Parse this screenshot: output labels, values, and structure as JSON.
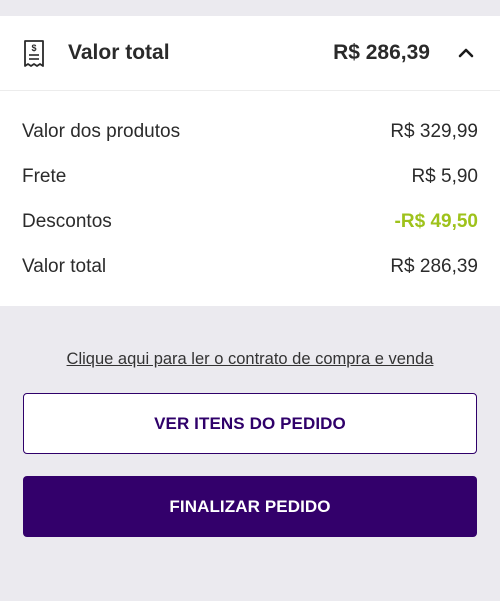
{
  "summary": {
    "title": "Valor total",
    "amount": "R$ 286,39",
    "receipt_icon": "receipt-dollar-icon",
    "chevron_icon": "chevron-up-icon",
    "rows": [
      {
        "label": "Valor dos produtos",
        "value": "R$ 329,99"
      },
      {
        "label": "Frete",
        "value": "R$ 5,90"
      },
      {
        "label": "Descontos",
        "value": "-R$ 49,50"
      },
      {
        "label": "Valor total",
        "value": "R$ 286,39"
      }
    ]
  },
  "footer": {
    "contract_link": "Clique aqui para ler o contrato de compra e venda",
    "view_items_label": "VER ITENS DO PEDIDO",
    "finalize_label": "FINALIZAR PEDIDO"
  },
  "colors": {
    "brand_purple": "#33006b",
    "discount_green": "#9ec21b",
    "background": "#ebeaef"
  }
}
